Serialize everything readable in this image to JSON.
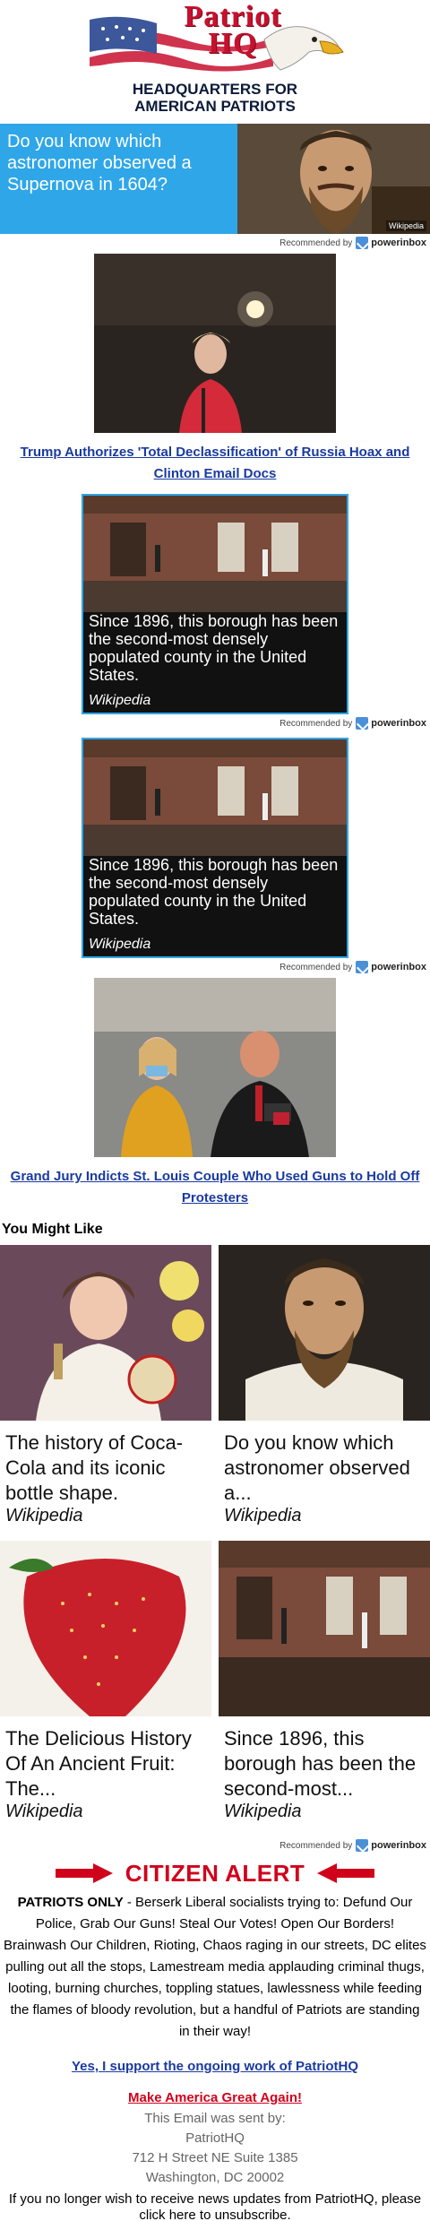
{
  "header": {
    "logo_title_1": "Patriot",
    "logo_title_2": "HQ",
    "tagline_1": "HEADQUARTERS FOR",
    "tagline_2": "AMERICAN PATRIOTS"
  },
  "banner_ad": {
    "text": "Do you know which astronomer observed a Supernova in 1604?",
    "credit": "Wikipedia"
  },
  "recommended": {
    "label": "Recommended by",
    "brand": "powerinbox"
  },
  "stories": [
    {
      "title": "Trump Authorizes 'Total Declassification' of Russia Hoax and Clinton Email Docs"
    },
    {
      "title": "Grand Jury Indicts St. Louis Couple Who Used Guns to Hold Off Protesters"
    }
  ],
  "borough_ad": {
    "caption": "Since 1896, this borough has been the second-most densely populated county in the United States.",
    "source": "Wikipedia"
  },
  "you_might_like": {
    "heading": "You Might Like",
    "cards": [
      {
        "title": "The history of Coca-Cola and its iconic bottle shape.",
        "source": "Wikipedia"
      },
      {
        "title": "Do you know which astronomer observed a...",
        "source": "Wikipedia"
      },
      {
        "title": "The Delicious History Of An Ancient Fruit: The...",
        "source": "Wikipedia"
      },
      {
        "title": "Since 1896, this borough has been the second-most...",
        "source": "Wikipedia"
      }
    ]
  },
  "citizen_alert": {
    "heading": "CITIZEN ALERT",
    "lead": "PATRIOTS ONLY",
    "body": " - Berserk Liberal socialists trying to: Defund Our Police, Grab Our Guns! Steal Our Votes! Open Our Borders! Brainwash Our Children, Rioting, Chaos raging in our streets, DC elites pulling out all the stops, Lamestream media applauding criminal thugs, looting, burning churches, toppling statues, lawlessness while feeding the flames of bloody revolution, but a handful of Patriots are standing in their way!",
    "support_link": "Yes, I support the ongoing work of PatriotHQ",
    "maga_link": "Make America Great Again!"
  },
  "footer": {
    "sent_by": "This Email was sent by:",
    "org": "PatriotHQ",
    "address_1": "712 H Street NE Suite 1385",
    "address_2": "Washington, DC 20002",
    "unsubscribe": "If you no longer wish to receive news updates from PatriotHQ, please click here to unsubscribe."
  },
  "colors": {
    "accent_blue": "#2fa6e8",
    "link_blue": "#1a3aa0",
    "alert_red": "#d0021b"
  }
}
